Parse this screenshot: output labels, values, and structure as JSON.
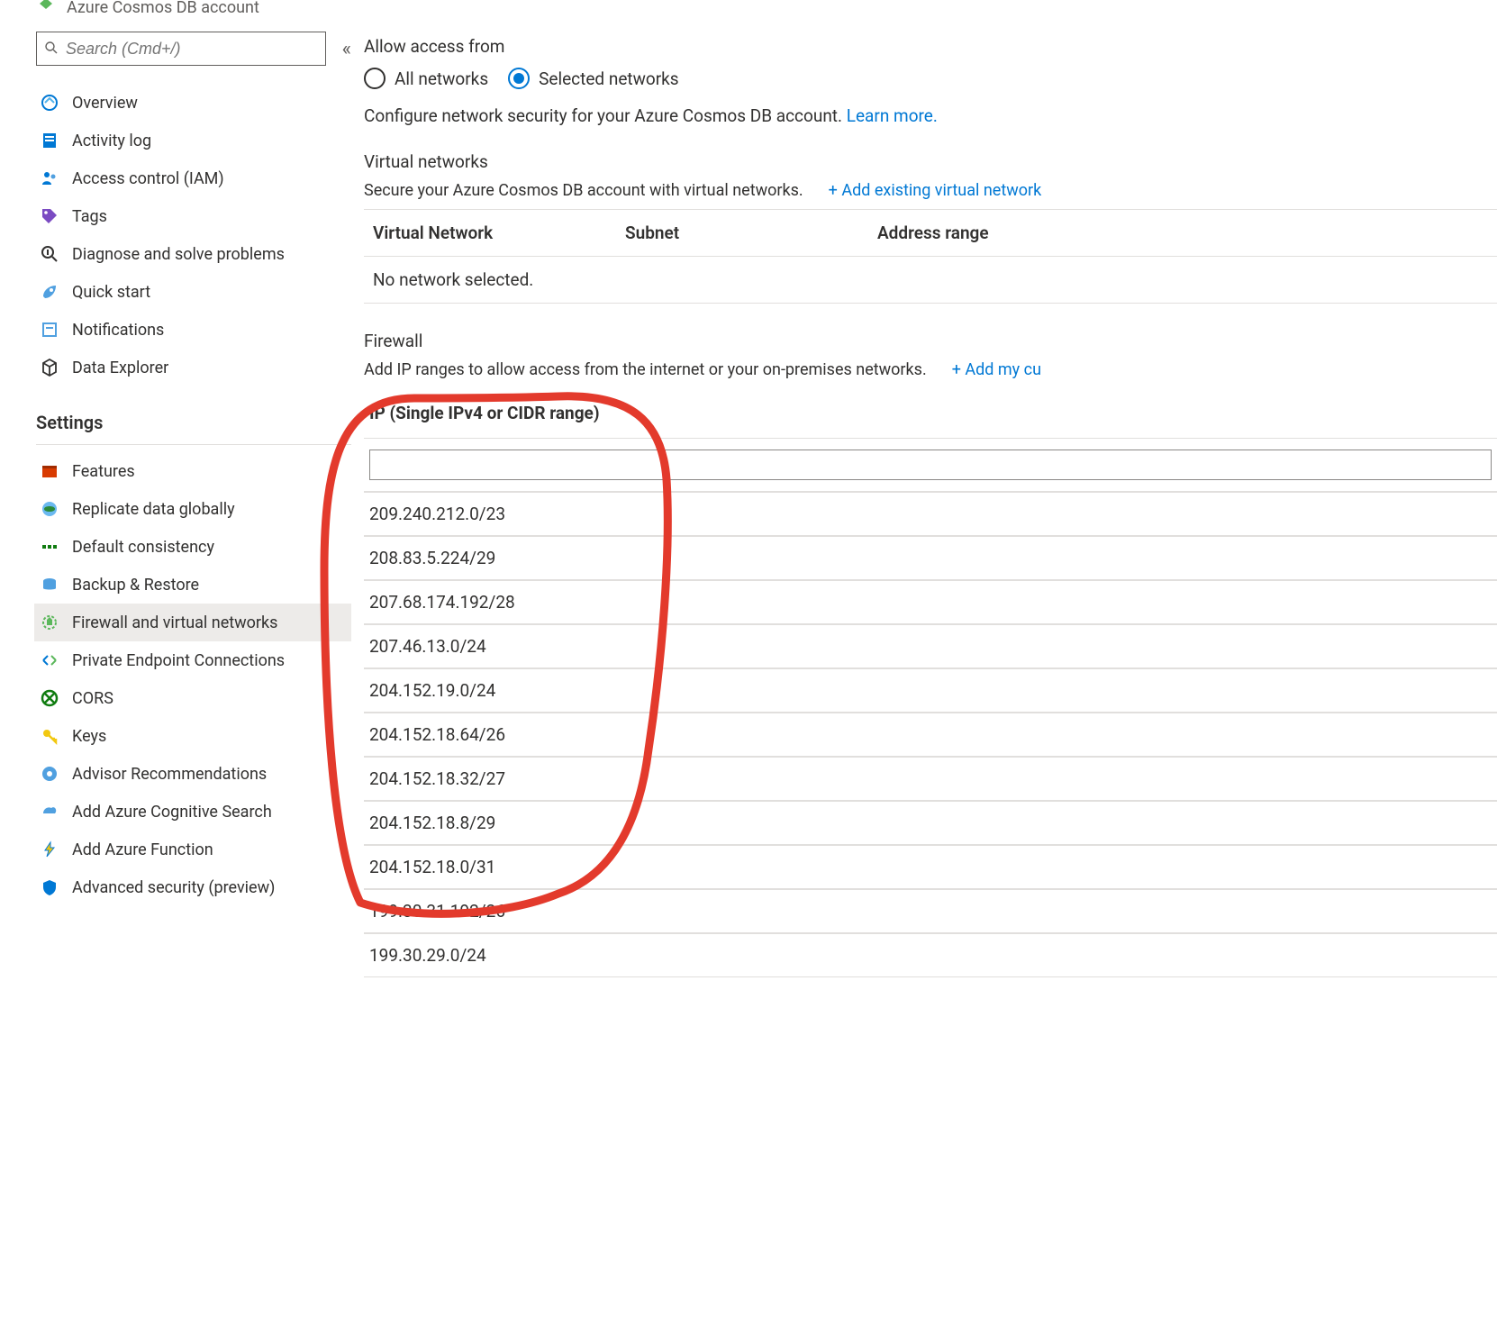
{
  "header": {
    "subtitle": "Azure Cosmos DB account"
  },
  "sidebar": {
    "search_placeholder": "Search (Cmd+/)",
    "items": [
      {
        "label": "Overview",
        "icon": "overview"
      },
      {
        "label": "Activity log",
        "icon": "activity-log"
      },
      {
        "label": "Access control (IAM)",
        "icon": "iam"
      },
      {
        "label": "Tags",
        "icon": "tags"
      },
      {
        "label": "Diagnose and solve problems",
        "icon": "diagnose"
      },
      {
        "label": "Quick start",
        "icon": "quickstart"
      },
      {
        "label": "Notifications",
        "icon": "notifications"
      },
      {
        "label": "Data Explorer",
        "icon": "dataexplorer"
      }
    ],
    "settings_header": "Settings",
    "settings": [
      {
        "label": "Features",
        "icon": "features"
      },
      {
        "label": "Replicate data globally",
        "icon": "replicate"
      },
      {
        "label": "Default consistency",
        "icon": "consistency"
      },
      {
        "label": "Backup & Restore",
        "icon": "backup"
      },
      {
        "label": "Firewall and virtual networks",
        "icon": "firewall",
        "active": true
      },
      {
        "label": "Private Endpoint Connections",
        "icon": "pec"
      },
      {
        "label": "CORS",
        "icon": "cors"
      },
      {
        "label": "Keys",
        "icon": "keys"
      },
      {
        "label": "Advisor Recommendations",
        "icon": "advisor"
      },
      {
        "label": "Add Azure Cognitive Search",
        "icon": "cognitive"
      },
      {
        "label": "Add Azure Function",
        "icon": "function"
      },
      {
        "label": "Advanced security (preview)",
        "icon": "security"
      }
    ]
  },
  "main": {
    "access_label": "Allow access from",
    "radio_all": "All networks",
    "radio_selected": "Selected networks",
    "desc": "Configure network security for your Azure Cosmos DB account. ",
    "desc_link": "Learn more.",
    "vnet": {
      "title": "Virtual networks",
      "desc": "Secure your Azure Cosmos DB account with virtual networks.",
      "add_link": "+ Add existing virtual network",
      "col1": "Virtual Network",
      "col2": "Subnet",
      "col3": "Address range",
      "empty": "No network selected."
    },
    "firewall": {
      "title": "Firewall",
      "desc": "Add IP ranges to allow access from the internet or your on-premises networks.",
      "add_link": "+ Add my cu",
      "col": "IP (Single IPv4 or CIDR range)",
      "ips": [
        "209.240.212.0/23",
        "208.83.5.224/29",
        "207.68.174.192/28",
        "207.46.13.0/24",
        "204.152.19.0/24",
        "204.152.18.64/26",
        "204.152.18.32/27",
        "204.152.18.8/29",
        "204.152.18.0/31",
        "199.30.31.192/26",
        "199.30.29.0/24"
      ]
    }
  }
}
